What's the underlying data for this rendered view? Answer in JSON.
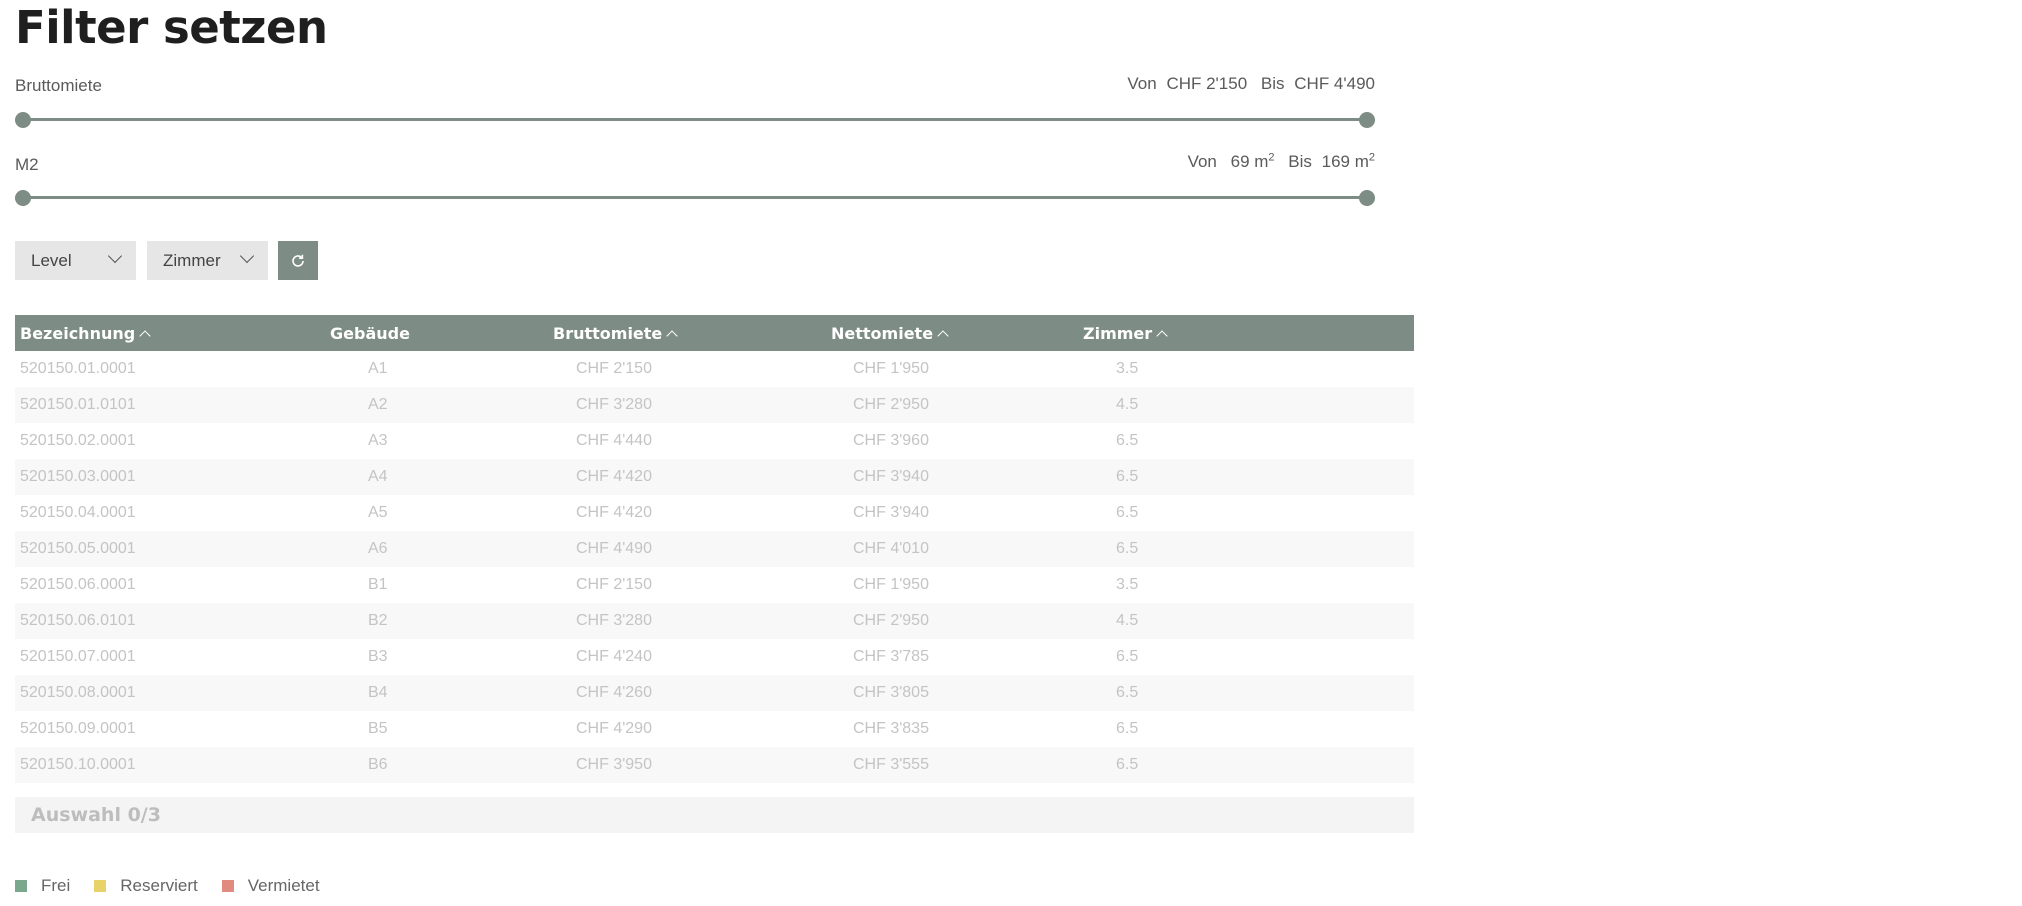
{
  "page": {
    "title": "Filter setzen"
  },
  "filters": {
    "rent": {
      "label": "Bruttomiete",
      "from_label": "Von",
      "from_value": "CHF 2'150",
      "to_label": "Bis",
      "to_value": "CHF 4'490",
      "min": 2150,
      "max": 4490,
      "selected_min": 2150,
      "selected_max": 4490
    },
    "area": {
      "label": "M2",
      "from_label": "Von",
      "from_value": "69 m",
      "to_label": "Bis",
      "to_value": "169 m",
      "unit_exp": "2",
      "min": 69,
      "max": 169,
      "selected_min": 69,
      "selected_max": 169
    },
    "dropdowns": {
      "level": "Level",
      "rooms": "Zimmer"
    },
    "reset_icon": "refresh-icon"
  },
  "table": {
    "headers": [
      "Bezeichnung",
      "Gebäude",
      "Bruttomiete",
      "Nettomiete",
      "Zimmer"
    ],
    "rows": [
      [
        "520150.01.0001",
        "A1",
        "CHF 2'150",
        "CHF 1'950",
        "3.5"
      ],
      [
        "520150.01.0101",
        "A2",
        "CHF 3'280",
        "CHF 2'950",
        "4.5"
      ],
      [
        "520150.02.0001",
        "A3",
        "CHF 4'440",
        "CHF 3'960",
        "6.5"
      ],
      [
        "520150.03.0001",
        "A4",
        "CHF 4'420",
        "CHF 3'940",
        "6.5"
      ],
      [
        "520150.04.0001",
        "A5",
        "CHF 4'420",
        "CHF 3'940",
        "6.5"
      ],
      [
        "520150.05.0001",
        "A6",
        "CHF 4'490",
        "CHF 4'010",
        "6.5"
      ],
      [
        "520150.06.0001",
        "B1",
        "CHF 2'150",
        "CHF 1'950",
        "3.5"
      ],
      [
        "520150.06.0101",
        "B2",
        "CHF 3'280",
        "CHF 2'950",
        "4.5"
      ],
      [
        "520150.07.0001",
        "B3",
        "CHF 4'240",
        "CHF 3'785",
        "6.5"
      ],
      [
        "520150.08.0001",
        "B4",
        "CHF 4'260",
        "CHF 3'805",
        "6.5"
      ],
      [
        "520150.09.0001",
        "B5",
        "CHF 4'290",
        "CHF 3'835",
        "6.5"
      ],
      [
        "520150.10.0001",
        "B6",
        "CHF 3'950",
        "CHF 3'555",
        "6.5"
      ]
    ]
  },
  "selection": {
    "text": "Auswahl 0/3"
  },
  "legend": [
    {
      "label": "Frei",
      "color": "#7aa88e"
    },
    {
      "label": "Reserviert",
      "color": "#e8d36a"
    },
    {
      "label": "Vermietet",
      "color": "#e08a80"
    }
  ],
  "colors": {
    "accent": "#7d8c85"
  }
}
